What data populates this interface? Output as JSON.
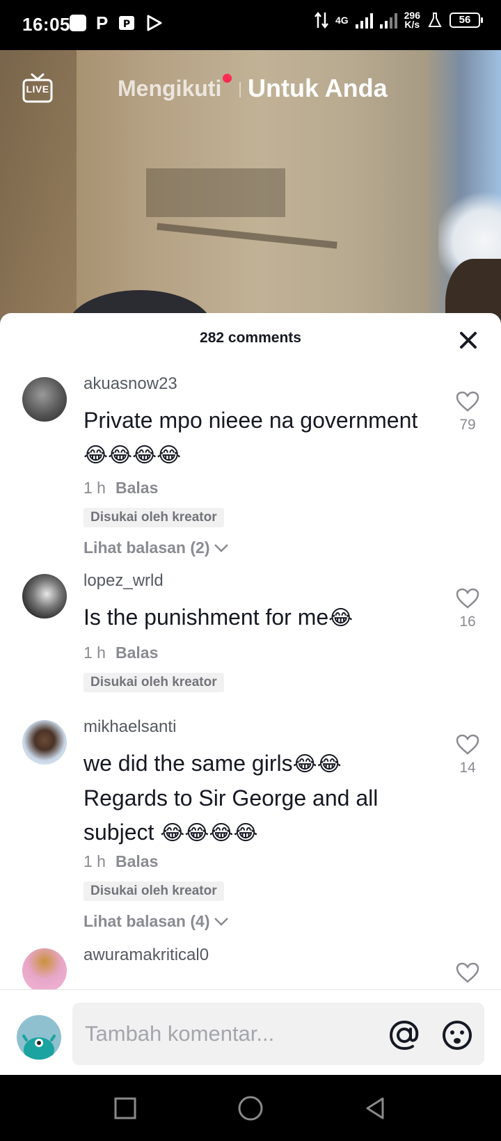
{
  "status_bar": {
    "time": "16:05",
    "network": "4G",
    "speed_value": "296",
    "speed_unit": "K/s",
    "battery": "56"
  },
  "top_nav": {
    "live_label": "LIVE",
    "tab_following": "Mengikuti",
    "tab_for_you": "Untuk Anda"
  },
  "comments_sheet": {
    "title": "282 comments",
    "comments": [
      {
        "username": "akuasnow23",
        "text": "Private mpo nieee na government",
        "emojis": "😂😂😂😂",
        "time": "1 h",
        "reply_label": "Balas",
        "badge": "Disukai oleh kreator",
        "view_replies": "Lihat balasan (2)",
        "likes": "79"
      },
      {
        "username": "lopez_wrld",
        "text": "Is the punishment for me",
        "emojis": "😂",
        "time": "1 h",
        "reply_label": "Balas",
        "badge": "Disukai oleh kreator",
        "likes": "16"
      },
      {
        "username": "mikhaelsanti",
        "text_line1": "we did the same girls",
        "emojis_line1": "😂😂",
        "text_line2": "Regards to Sir George and all",
        "text_line3": "subject",
        "emojis_line3": "😂😂😂😂",
        "time": "1 h",
        "reply_label": "Balas",
        "badge": "Disukai oleh kreator",
        "view_replies": "Lihat balasan (4)",
        "likes": "14"
      },
      {
        "username": "awuramakritical0"
      }
    ]
  },
  "input": {
    "placeholder": "Tambah komentar..."
  },
  "colors": {
    "accent_dot": "#fe2c55",
    "text_primary": "#161823",
    "text_secondary": "#8a8b91"
  }
}
